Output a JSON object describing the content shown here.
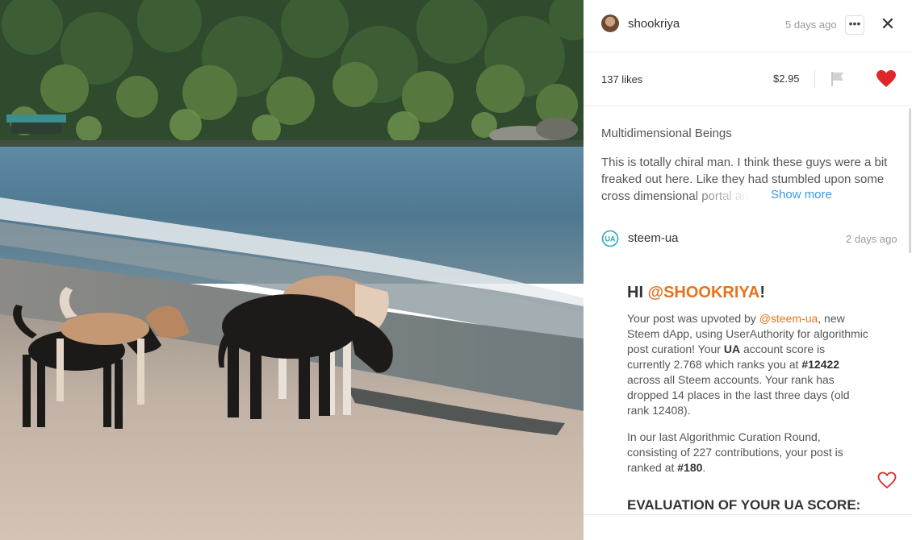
{
  "post": {
    "author": "shookriya",
    "time": "5 days ago",
    "more_label": "•••",
    "close_label": "✕",
    "likes": "137 likes",
    "payout": "$2.95",
    "title": "Multidimensional Beings",
    "description": "This is totally chiral man. I think these guys were a bit freaked out here. Like they had stumbled upon some cross dimensional portal and",
    "show_more": "Show more"
  },
  "comment": {
    "author": "steem-ua",
    "time": "2 days ago",
    "greeting_prefix": "HI ",
    "greeting_mention": "@SHOOKRIYA",
    "greeting_suffix": "!",
    "p1_a": "Your post was upvoted by ",
    "p1_link": "@steem-ua",
    "p1_b": ", new Steem dApp, using UserAuthority for algorithmic post curation! Your ",
    "p1_ua": "UA",
    "p1_c": " account score is currently 2.768 which ranks you at ",
    "p1_rank": "#12422",
    "p1_d": " across all Steem accounts. Your rank has dropped 14 places in the last three days (old rank 12408).",
    "p2_a": "In our last Algorithmic Curation Round, consisting of 227 contributions, your post is ranked at ",
    "p2_rank": "#180",
    "p2_b": ".",
    "eval_heading": "EVALUATION OF YOUR UA SCORE:"
  },
  "colors": {
    "accent_orange": "#e6731c",
    "link_blue": "#3b9ae1",
    "heart_red": "#e0262a"
  },
  "icons": {
    "more": "ellipsis-icon",
    "close": "close-icon",
    "flag": "flag-icon",
    "liked": "heart-filled-icon",
    "comment_like": "heart-outline-icon",
    "commenter_avatar": "steem-ua-logo"
  }
}
